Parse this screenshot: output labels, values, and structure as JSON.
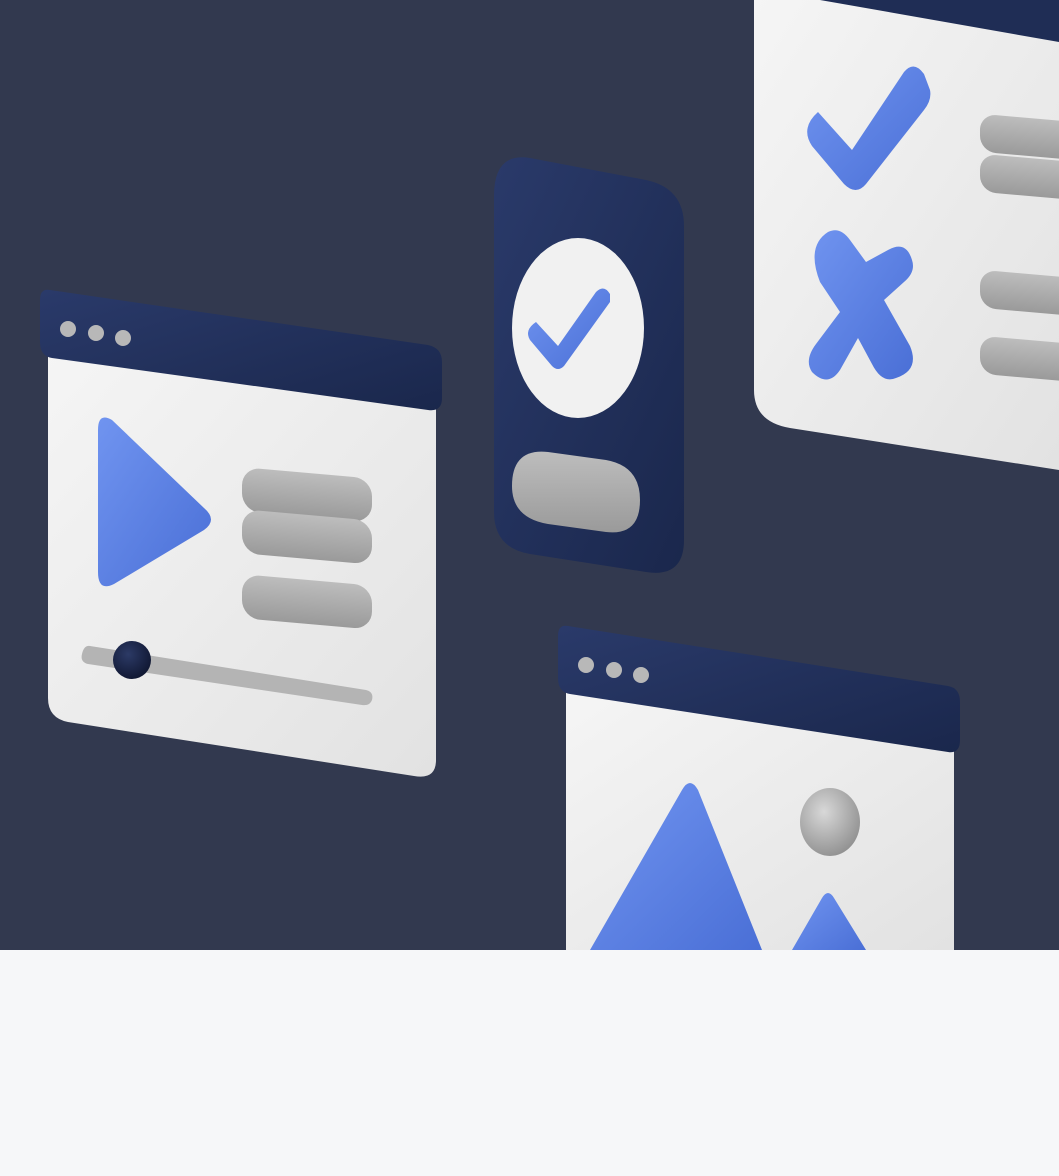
{
  "colors": {
    "hero_background": "#32394f",
    "page_background": "#f6f7f9",
    "window_panel": "#eeeeee",
    "window_titlebar": "#1f2d55",
    "accent_blue": "#5a7fe0",
    "placeholder_gray": "#a9a9a9",
    "slider_knob": "#141d3a"
  },
  "illustration": {
    "video_window": {
      "icons": [
        "window-dot-icon",
        "window-dot-icon",
        "window-dot-icon",
        "play-icon"
      ],
      "text_lines": 3,
      "slider_position": 0.05
    },
    "phone": {
      "icons": [
        "check-circle-icon"
      ],
      "button": "pill-button"
    },
    "checklist_window": {
      "icons": [
        "check-icon",
        "cross-icon"
      ],
      "text_lines": 4
    },
    "image_window": {
      "icons": [
        "window-dot-icon",
        "window-dot-icon",
        "window-dot-icon",
        "mountain-icon",
        "sun-icon"
      ]
    }
  }
}
